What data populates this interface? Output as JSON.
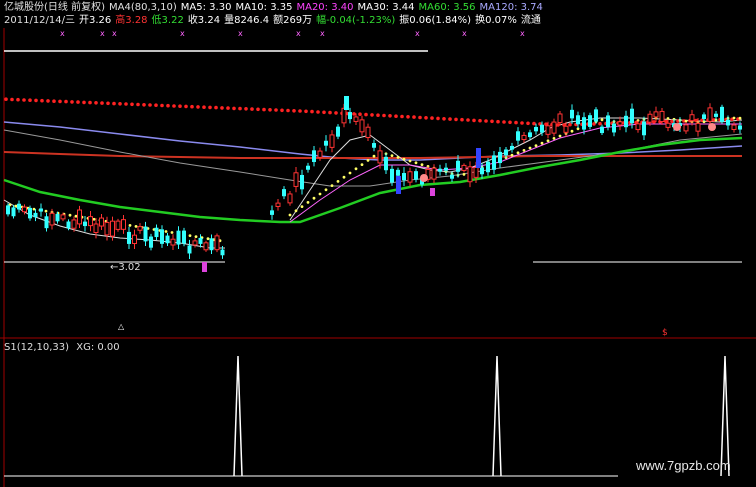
{
  "header": {
    "row1": [
      {
        "text": "亿城股份(日线 前复权)",
        "color": "#e0e0e0"
      },
      {
        "text": "MA4(80,3,10)",
        "color": "#e0e0e0"
      },
      {
        "text": "MA5: 3.30",
        "color": "#ffffff"
      },
      {
        "text": "MA10: 3.35",
        "color": "#ffffff"
      },
      {
        "text": "MA20: 3.40",
        "color": "#ff44ff"
      },
      {
        "text": "MA30: 3.44",
        "color": "#ffffff"
      },
      {
        "text": "MA60: 3.56",
        "color": "#33dd33"
      },
      {
        "text": "MA120: 3.74",
        "color": "#aaaaff"
      }
    ],
    "row2": [
      {
        "text": "2011/12/14/三",
        "color": "#e0e0e0"
      },
      {
        "text": "开3.26",
        "color": "#ffffff"
      },
      {
        "text": "高3.28",
        "color": "#ff3333"
      },
      {
        "text": "低3.22",
        "color": "#33dd33"
      },
      {
        "text": "收3.24",
        "color": "#ffffff"
      },
      {
        "text": "量8246.4",
        "color": "#ffffff"
      },
      {
        "text": "额269万",
        "color": "#ffffff"
      },
      {
        "text": "幅-0.04(-1.23%)",
        "color": "#33dd33"
      },
      {
        "text": "振0.06(1.84%)",
        "color": "#ffffff"
      },
      {
        "text": "换0.07%",
        "color": "#ffffff"
      },
      {
        "text": "流通",
        "color": "#ffffff"
      }
    ]
  },
  "price_annotation": "←3.02",
  "indicator": {
    "label": "S1(12,10,33)",
    "xg": "XG: 0.00"
  },
  "watermark": "www.7gpzb.com",
  "colors": {
    "background": "#000000",
    "up": "#ff3333",
    "down": "#33ffff",
    "ma60": "#22cc22",
    "ma120": "#8888ff",
    "dots_red": "#ff2222",
    "dots_yellow": "#ffff66",
    "spike": "#ffffff"
  },
  "indicator_spikes": [
    {
      "bar_index": 40,
      "value": 1
    },
    {
      "bar_index": 83,
      "value": 1
    },
    {
      "bar_index": 121,
      "value": 1
    }
  ]
}
